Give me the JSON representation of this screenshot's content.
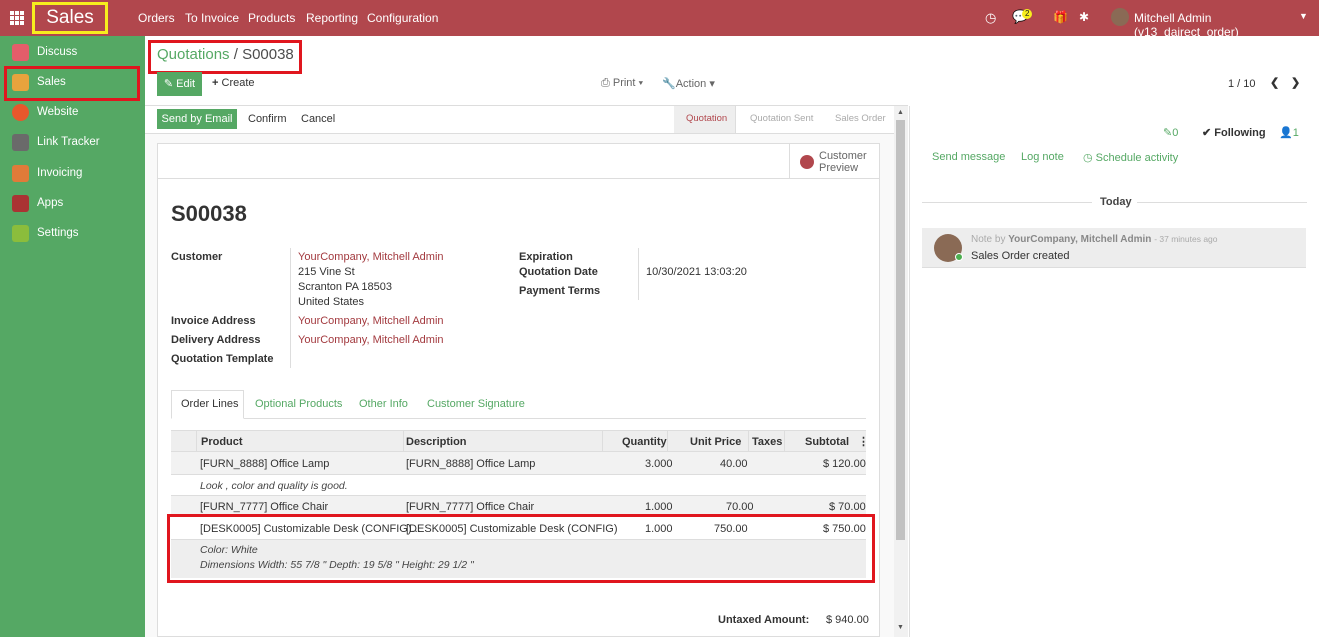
{
  "topbar": {
    "brand": "Sales",
    "menu": [
      "Orders",
      "To Invoice",
      "Products",
      "Reporting",
      "Configuration"
    ],
    "messages_count": "2",
    "user": "Mitchell Admin (v13_dairect_order)"
  },
  "sidebar": {
    "items": [
      {
        "label": "Discuss",
        "icon": "discuss-icon",
        "color": "#e35d6a"
      },
      {
        "label": "Sales",
        "icon": "sales-chart-icon",
        "color": "#e8a33d"
      },
      {
        "label": "Website",
        "icon": "globe-icon",
        "color": "#e8572c"
      },
      {
        "label": "Link Tracker",
        "icon": "link-icon",
        "color": "#6a6a6a"
      },
      {
        "label": "Invoicing",
        "icon": "invoice-icon",
        "color": "#e07b39"
      },
      {
        "label": "Apps",
        "icon": "apps-cubes-icon",
        "color": "#a33"
      },
      {
        "label": "Settings",
        "icon": "gear-icon",
        "color": "#8bbd3c"
      }
    ]
  },
  "breadcrumb": {
    "parent": "Quotations",
    "separator": "/",
    "current": "S00038"
  },
  "actions": {
    "edit": "Edit",
    "create": "Create",
    "print": "Print",
    "action": "Action",
    "pager": "1 / 10"
  },
  "statusbar": {
    "send_email": "Send by Email",
    "confirm": "Confirm",
    "cancel": "Cancel",
    "stages": [
      "Quotation",
      "Quotation Sent",
      "Sales Order"
    ]
  },
  "form": {
    "preview_label_1": "Customer",
    "preview_label_2": "Preview",
    "name": "S00038",
    "customer_label": "Customer",
    "customer_name": "YourCompany, Mitchell Admin",
    "address_1": "215 Vine St",
    "address_2": "Scranton PA 18503",
    "address_3": "United States",
    "invoice_address_label": "Invoice Address",
    "invoice_address": "YourCompany, Mitchell Admin",
    "delivery_address_label": "Delivery Address",
    "delivery_address": "YourCompany, Mitchell Admin",
    "template_label": "Quotation Template",
    "expiration_label": "Expiration",
    "quotation_date_label": "Quotation Date",
    "quotation_date": "10/30/2021 13:03:20",
    "payment_terms_label": "Payment Terms",
    "tabs": [
      "Order Lines",
      "Optional Products",
      "Other Info",
      "Customer Signature"
    ],
    "columns": [
      "Product",
      "Description",
      "Quantity",
      "Unit Price",
      "Taxes",
      "Subtotal"
    ],
    "lines": [
      {
        "product": "[FURN_8888] Office Lamp",
        "description": "[FURN_8888] Office Lamp",
        "qty": "3.000",
        "price": "40.00",
        "subtotal": "$ 120.00"
      },
      {
        "note": "Look , color and quality is good."
      },
      {
        "product": "[FURN_7777] Office Chair",
        "description": "[FURN_7777] Office Chair",
        "qty": "1.000",
        "price": "70.00",
        "subtotal": "$ 70.00"
      },
      {
        "product": "[DESK0005] Customizable Desk (CONFIG)...",
        "description": "[DESK0005] Customizable Desk (CONFIG)",
        "qty": "1.000",
        "price": "750.00",
        "subtotal": "$ 750.00"
      },
      {
        "note": "Color: White"
      },
      {
        "note": "Dimensions Width: 55 7/8 \" Depth: 19 5/8 \" Height: 29 1/2 \""
      }
    ],
    "untaxed_label": "Untaxed Amount:",
    "untaxed_value": "$ 940.00"
  },
  "chatter": {
    "followers_count": "0",
    "following": "Following",
    "members_count": "1",
    "send_message": "Send message",
    "log_note": "Log note",
    "schedule_activity": "Schedule activity",
    "today": "Today",
    "note_prefix": "Note by",
    "author": "YourCompany, Mitchell Admin",
    "time": "- 37 minutes ago",
    "body": "Sales Order created"
  },
  "colors": {
    "topbar": "#b1474d",
    "sidebar": "#55a864",
    "accent": "#55a864",
    "link": "#a33a3f",
    "highlight": "#e0161e",
    "brand_box": "#f7ee1e"
  }
}
